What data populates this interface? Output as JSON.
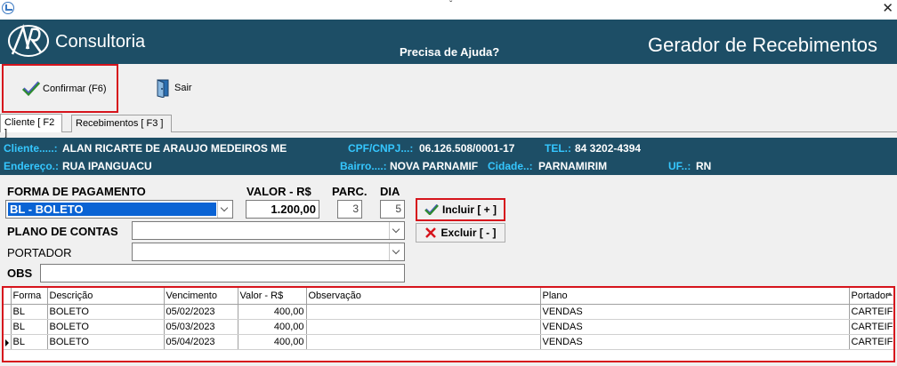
{
  "titlebar": {
    "center_mark": "ˇ",
    "close_glyph": "✕"
  },
  "banner": {
    "logo_text": "AR",
    "brand": "Consultoria",
    "help": "Precisa de Ajuda?",
    "title": "Gerador de Recebimentos"
  },
  "toolbar": {
    "confirm_label": "Confirmar (F6)",
    "exit_label": "Sair"
  },
  "tabs": [
    {
      "label": "Cliente [ F2 ]",
      "active": true
    },
    {
      "label": "Recebimentos [ F3 ]",
      "active": false
    }
  ],
  "client": {
    "cliente_label": "Cliente.....:",
    "cliente": "ALAN RICARTE DE ARAUJO MEDEIROS  ME",
    "cpf_label": "CPF/CNPJ...:",
    "cpf": "06.126.508/0001-17",
    "tel_label": "TEL.:",
    "tel": "84 3202-4394",
    "endereco_label": "Endereço.:",
    "endereco": "RUA IPANGUACU",
    "bairro_label": "Bairro....:",
    "bairro": "NOVA PARNAMIF",
    "cidade_label": "Cidade..:",
    "cidade": "PARNAMIRIM",
    "uf_label": "UF..:",
    "uf": "RN"
  },
  "form": {
    "forma_label": "FORMA DE PAGAMENTO",
    "forma_value": "BL - BOLETO",
    "valor_label": "VALOR - R$",
    "valor_value": "1.200,00",
    "parc_label": "PARC.",
    "parc_value": "3",
    "dia_label": "DIA",
    "dia_value": "5",
    "plano_label": "PLANO DE CONTAS",
    "plano_value": "",
    "portador_label": "PORTADOR",
    "portador_value": "",
    "obs_label": "OBS",
    "obs_value": "",
    "include_label": "Incluir [ + ]",
    "exclude_label": "Excluir [ - ]"
  },
  "grid": {
    "columns": [
      "Forma",
      "Descrição",
      "Vencimento",
      "Valor - R$",
      "Observação",
      "Plano",
      "Portador"
    ],
    "rows": [
      {
        "forma": "BL",
        "descricao": "BOLETO",
        "vencimento": "05/02/2023",
        "valor": "400,00",
        "obs": "",
        "plano": "VENDAS",
        "portador": "CARTEIF"
      },
      {
        "forma": "BL",
        "descricao": "BOLETO",
        "vencimento": "05/03/2023",
        "valor": "400,00",
        "obs": "",
        "plano": "VENDAS",
        "portador": "CARTEIF"
      },
      {
        "forma": "BL",
        "descricao": "BOLETO",
        "vencimento": "05/04/2023",
        "valor": "400,00",
        "obs": "",
        "plano": "VENDAS",
        "portador": "CARTEIF"
      }
    ]
  },
  "colors": {
    "banner": "#1d4e66",
    "label_cyan": "#35c7ff",
    "highlight_red": "#d6141c",
    "selection_blue": "#0a63d4"
  }
}
